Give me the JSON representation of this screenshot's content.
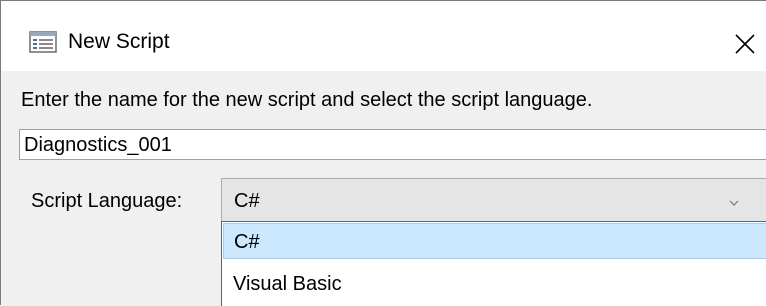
{
  "dialog": {
    "title": "New Script",
    "title_icon": "script-window-icon",
    "close_icon": "close-icon"
  },
  "form": {
    "prompt": "Enter the name for the new script and select the script language.",
    "name_value": "Diagnostics_001",
    "language_label": "Script Language:",
    "language_selected": "C#",
    "language_options": [
      "C#",
      "Visual Basic"
    ]
  },
  "colors": {
    "hover_bg": "#cce8ff",
    "hover_border": "#99d1ff",
    "dialog_bg": "#f0f0f0"
  }
}
